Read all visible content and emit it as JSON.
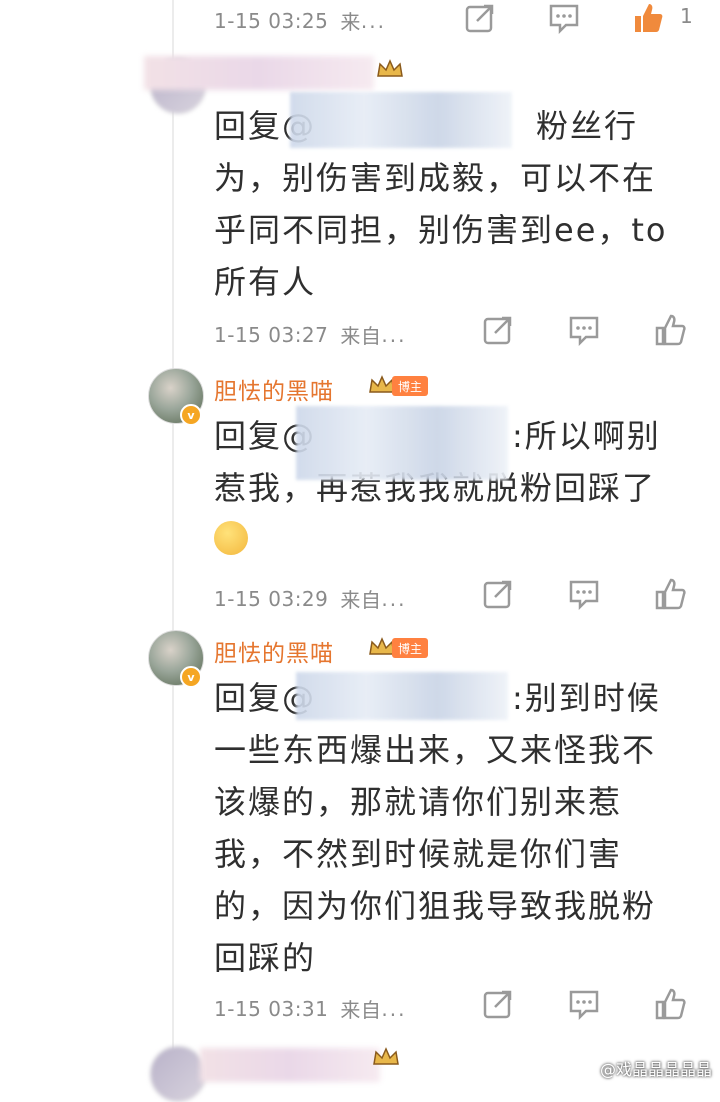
{
  "comments": [
    {
      "time": "1-15 03:25",
      "source": "来",
      "like_count": "1"
    },
    {
      "username": "",
      "content_before": "回复@",
      "content_after": "粉丝行为，别伤害到成毅，可以不在乎同不同担，别伤害到ee，to 所有人",
      "time": "1-15 03:27",
      "source": "来自",
      "more": "..."
    },
    {
      "username": "胆怯的黑喵",
      "badge": "博主",
      "content_before": "回复@",
      "content_after": ":所以啊别惹我，再惹我我就脱粉回踩了",
      "time": "1-15 03:29",
      "source": "来自",
      "more": "..."
    },
    {
      "username": "胆怯的黑喵",
      "badge": "博主",
      "content_before": "回复@",
      "content_after": ":别到时候一些东西爆出来，又来怪我不该爆的，那就请你们别来惹我，不然到时候就是你们害的，因为你们狙我导致我脱粉回踩的",
      "time": "1-15 03:31",
      "source": "来自",
      "more": "..."
    }
  ],
  "watermark": "@戏晶晶晶晶晶",
  "colors": {
    "username": "#e5762f",
    "badge": "#ff8140",
    "meta": "#8a8a8a",
    "like_active": "#f08a3c"
  },
  "icons": {
    "share": "share-icon",
    "comment": "comment-icon",
    "like": "thumbs-up-icon",
    "crown": "crown-icon"
  }
}
